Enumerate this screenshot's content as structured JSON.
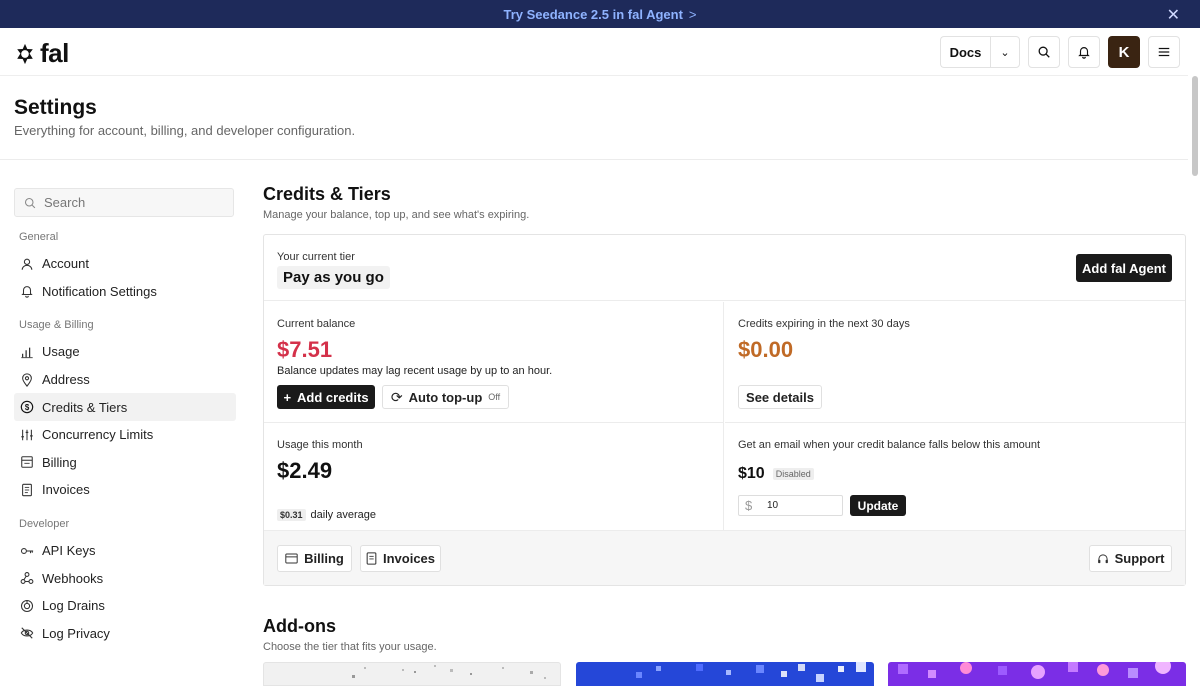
{
  "banner": {
    "text": "Try Seedance 2.5 in fal Agent",
    "chevron": ">"
  },
  "brand": {
    "name": "fal"
  },
  "topbar": {
    "docs_label": "Docs",
    "avatar_letter": "K"
  },
  "header": {
    "title": "Settings",
    "subtitle": "Everything for account, billing, and developer configuration."
  },
  "sidebar": {
    "search_placeholder": "Search",
    "groups": [
      {
        "label": "General",
        "items": [
          "Account",
          "Notification Settings"
        ]
      },
      {
        "label": "Usage & Billing",
        "items": [
          "Usage",
          "Address",
          "Credits & Tiers",
          "Concurrency Limits",
          "Billing",
          "Invoices"
        ]
      },
      {
        "label": "Developer",
        "items": [
          "API Keys",
          "Webhooks",
          "Log Drains",
          "Log Privacy"
        ]
      }
    ]
  },
  "credits": {
    "title": "Credits & Tiers",
    "subtitle": "Manage your balance, top up, and see what's expiring.",
    "tier_label": "Your current tier",
    "tier_value": "Pay as you go",
    "agent_button": "Add fal Agent",
    "balance_label": "Current balance",
    "balance_value": "$7.51",
    "balance_note": "Balance updates may lag recent usage by up to an hour.",
    "add_credits": "Add credits",
    "auto_topup": "Auto top-up",
    "auto_topup_state": "Off",
    "expiring_label": "Credits expiring in the next 30 days",
    "expiring_value": "$0.00",
    "see_details": "See details",
    "usage_label": "Usage this month",
    "usage_value": "$2.49",
    "daily_avg_value": "$0.31",
    "daily_avg_label": "daily average",
    "alert_label": "Get an email when your credit balance falls below this amount",
    "alert_value": "$10",
    "alert_state": "Disabled",
    "alert_currency": "$",
    "alert_input": "10",
    "update_button": "Update",
    "billing_button": "Billing",
    "invoices_button": "Invoices",
    "support_button": "Support"
  },
  "addons": {
    "title": "Add-ons",
    "subtitle": "Choose the tier that fits your usage."
  },
  "colors": {
    "banner_bg": "#1e2a5a",
    "balance_red": "#d4314a",
    "expiring_orange": "#c06a26"
  }
}
